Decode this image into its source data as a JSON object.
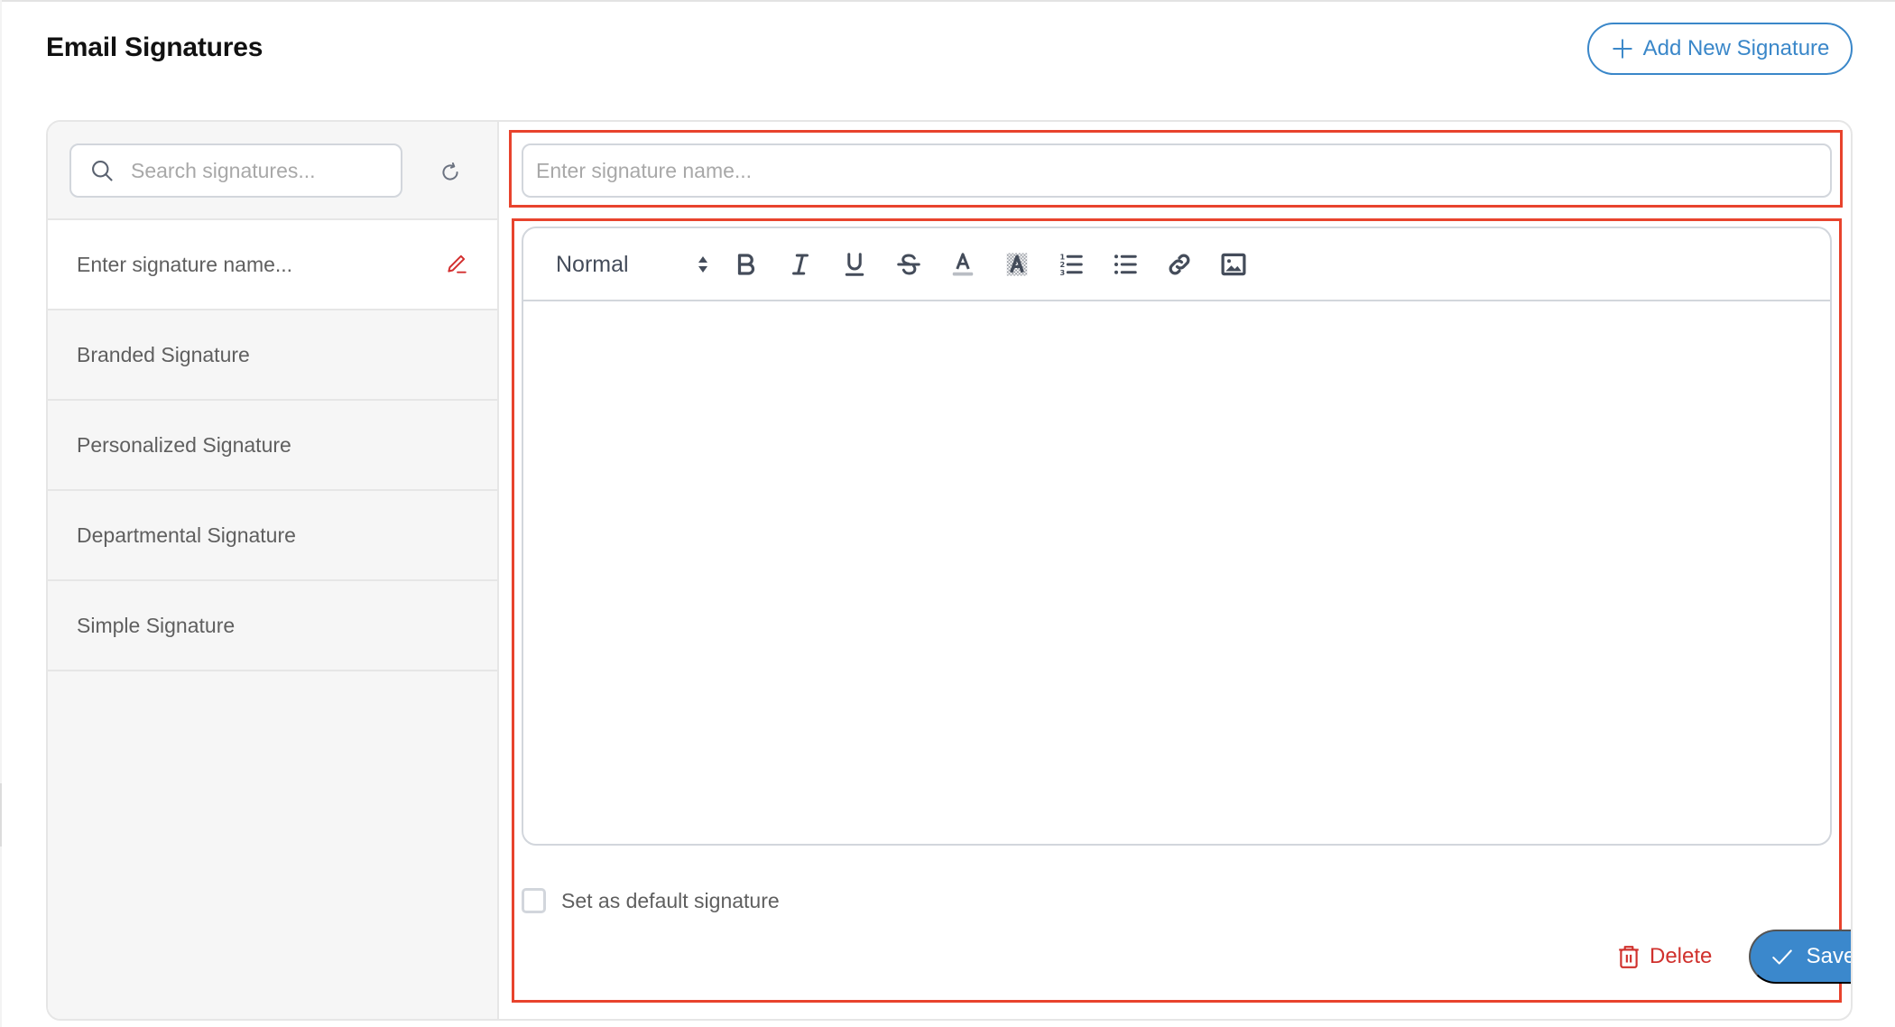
{
  "header": {
    "title": "Email Signatures",
    "add_button_label": "Add New Signature"
  },
  "sidebar": {
    "search_placeholder": "Search signatures...",
    "search_value": "",
    "items": [
      {
        "label": "Enter signature name...",
        "active": true,
        "editing": true
      },
      {
        "label": "Branded Signature",
        "active": false
      },
      {
        "label": "Personalized Signature",
        "active": false
      },
      {
        "label": "Departmental Signature",
        "active": false
      },
      {
        "label": "Simple Signature",
        "active": false
      }
    ]
  },
  "editor": {
    "name_placeholder": "Enter signature name...",
    "name_value": "",
    "format_selected": "Normal",
    "toolbar": [
      {
        "name": "bold",
        "icon": "bold-icon"
      },
      {
        "name": "italic",
        "icon": "italic-icon"
      },
      {
        "name": "underline",
        "icon": "underline-icon"
      },
      {
        "name": "strikethrough",
        "icon": "strikethrough-icon"
      },
      {
        "name": "text-color",
        "icon": "text-color-icon"
      },
      {
        "name": "background-color",
        "icon": "highlight-icon"
      },
      {
        "name": "ordered-list",
        "icon": "ordered-list-icon"
      },
      {
        "name": "bullet-list",
        "icon": "bullet-list-icon"
      },
      {
        "name": "link",
        "icon": "link-icon"
      },
      {
        "name": "image",
        "icon": "image-icon"
      }
    ],
    "content": "",
    "default_checkbox_label": "Set as default signature",
    "default_checked": false,
    "delete_label": "Delete",
    "save_label": "Save"
  },
  "colors": {
    "primary": "#3b88cc",
    "danger": "#d0312d",
    "highlight_outline": "#e8432d",
    "icon": "#444c5a"
  }
}
